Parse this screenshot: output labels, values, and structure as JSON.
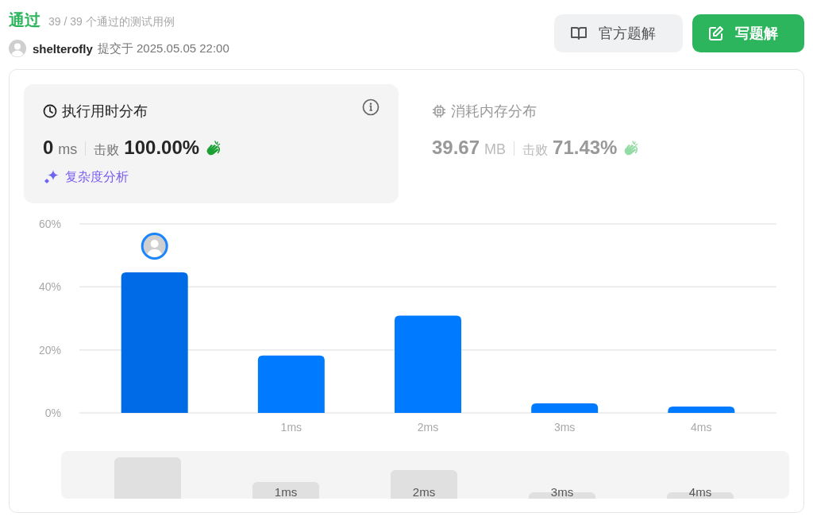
{
  "header": {
    "status": "通过",
    "summary": "39 / 39 个通过的测试用例",
    "user": "shelterofly",
    "submitted": "提交于 2025.05.05 22:00"
  },
  "buttons": [
    {
      "label": "官方题解",
      "kind": "secondary"
    },
    {
      "label": "写题解",
      "kind": "primary"
    }
  ],
  "panels": [
    {
      "kind": "runtime",
      "title": "执行用时分布",
      "value": "0",
      "unit": "ms",
      "beats_label": "击败",
      "beats": "100.00%",
      "selected": true,
      "link": "复杂度分析"
    },
    {
      "kind": "memory",
      "title": "消耗内存分布",
      "value": "39.67",
      "unit": "MB",
      "beats_label": "击败",
      "beats": "71.43%",
      "selected": false
    }
  ],
  "chart": {
    "chart_data": {
      "type": "bar",
      "x": [
        0,
        1,
        2,
        3,
        4
      ],
      "xticks": [
        {
          "value": 1,
          "label": "1ms"
        },
        {
          "value": 2,
          "label": "2ms"
        },
        {
          "value": 3,
          "label": "3ms"
        },
        {
          "value": 4,
          "label": "4ms"
        }
      ],
      "ylim": [
        0,
        60
      ],
      "yticks": [
        {
          "value": 0,
          "label": "0%"
        },
        {
          "value": 20,
          "label": "20%"
        },
        {
          "value": 40,
          "label": "40%"
        },
        {
          "value": 60,
          "label": "60%"
        }
      ],
      "xlim": [
        -0.55,
        4.55
      ],
      "series": [
        {
          "values": [
            44.6,
            18.2,
            30.9,
            3.0,
            2.0
          ]
        }
      ]
    },
    "bars": [
      {
        "selected": true
      },
      {
        "selected": false
      },
      {
        "selected": false
      },
      {
        "selected": false
      },
      {
        "selected": false
      }
    ]
  },
  "overview": {
    "labels": [
      "1ms",
      "2ms",
      "3ms",
      "4ms"
    ]
  }
}
